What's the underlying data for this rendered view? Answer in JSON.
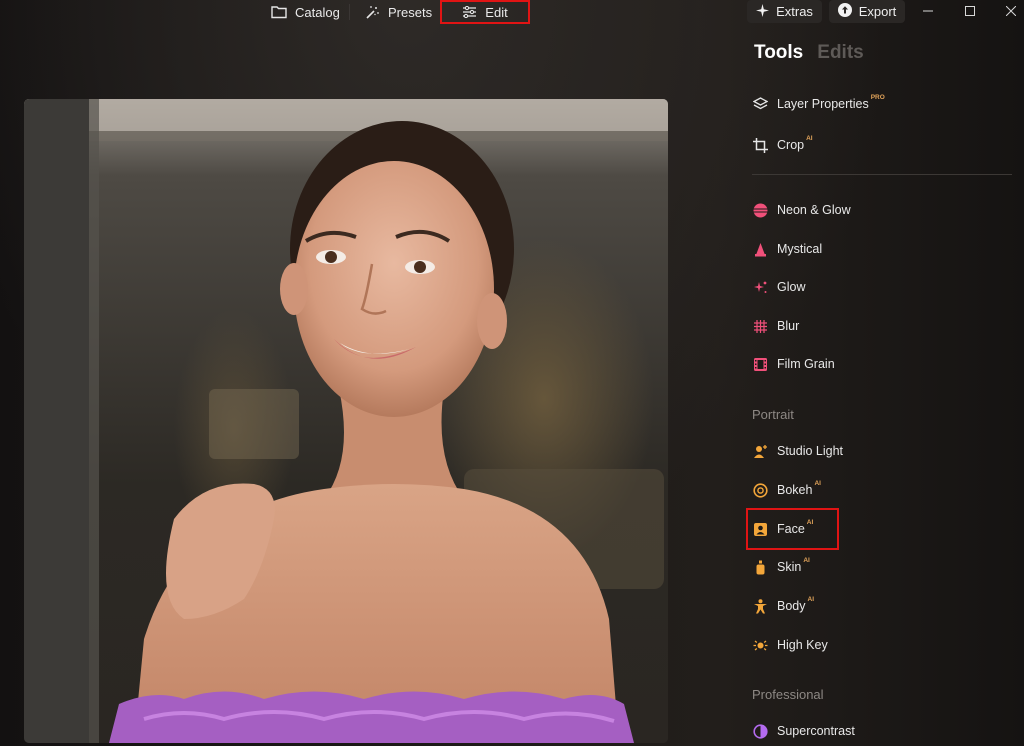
{
  "nav": {
    "catalog": "Catalog",
    "presets": "Presets",
    "edit": "Edit"
  },
  "actions": {
    "extras": "Extras",
    "export": "Export"
  },
  "panel": {
    "tabs": [
      "Tools",
      "Edits"
    ],
    "active_tab": "Tools",
    "tools_top": [
      {
        "label": "Layer Properties",
        "badge": "PRO",
        "icon": "layers-icon"
      },
      {
        "label": "Crop",
        "badge": "AI",
        "icon": "crop-icon"
      }
    ],
    "creative": [
      {
        "label": "Neon & Glow",
        "icon": "neon-glow-icon"
      },
      {
        "label": "Mystical",
        "icon": "mystical-icon"
      },
      {
        "label": "Glow",
        "icon": "glow-sparkle-icon"
      },
      {
        "label": "Blur",
        "icon": "blur-grid-icon"
      },
      {
        "label": "Film Grain",
        "icon": "film-icon"
      }
    ],
    "portrait_label": "Portrait",
    "portrait": [
      {
        "label": "Studio Light",
        "badge": "",
        "icon": "studio-light-icon"
      },
      {
        "label": "Bokeh",
        "badge": "AI",
        "icon": "bokeh-icon"
      },
      {
        "label": "Face",
        "badge": "AI",
        "icon": "face-icon"
      },
      {
        "label": "Skin",
        "badge": "AI",
        "icon": "skin-bottle-icon"
      },
      {
        "label": "Body",
        "badge": "AI",
        "icon": "body-icon"
      },
      {
        "label": "High Key",
        "badge": "",
        "icon": "high-key-icon"
      }
    ],
    "professional_label": "Professional",
    "professional": [
      {
        "label": "Supercontrast",
        "icon": "supercontrast-icon"
      }
    ]
  },
  "colors": {
    "highlight": "#e01414",
    "badge": "#e1a35a",
    "creative_accent": "#f0507a",
    "portrait_accent": "#f3a63a",
    "professional_accent": "#b46bf0"
  }
}
